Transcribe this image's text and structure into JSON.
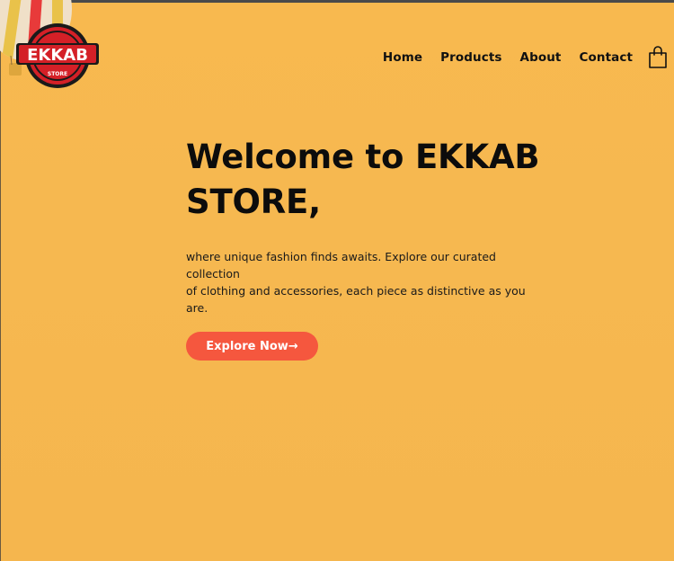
{
  "brand": {
    "logo_text": "EKKAB",
    "logo_subtext": "STORE"
  },
  "nav": {
    "items": [
      {
        "label": "Home"
      },
      {
        "label": "Products"
      },
      {
        "label": "About"
      },
      {
        "label": "Contact"
      }
    ]
  },
  "icons": {
    "cart": "shopping-bag-icon",
    "balloon": "hot-air-balloon-icon"
  },
  "hero": {
    "title_line1": "Welcome to EKKAB",
    "title_line2": "STORE,",
    "text_line1": "where unique fashion finds awaits. Explore our curated",
    "text_line2": "collection",
    "text_line3": "of clothing and accessories, each piece as distinctive as you",
    "text_line4": "are.",
    "cta_label": "Explore Now→"
  },
  "colors": {
    "background": "#f7b84f",
    "accent": "#f5573e",
    "logo_red": "#d42027",
    "text": "#0c0c0c"
  }
}
